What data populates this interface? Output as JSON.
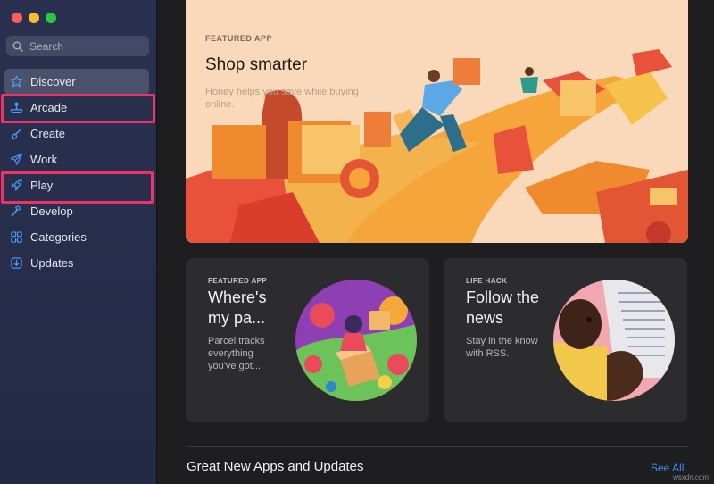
{
  "window": {
    "traffic_lights": [
      "close",
      "minimize",
      "zoom"
    ]
  },
  "sidebar": {
    "search_placeholder": "Search",
    "items": [
      {
        "label": "Discover",
        "icon": "star-icon",
        "selected": true
      },
      {
        "label": "Arcade",
        "icon": "joystick-icon",
        "highlighted": true
      },
      {
        "label": "Create",
        "icon": "brush-icon"
      },
      {
        "label": "Work",
        "icon": "paper-plane-icon"
      },
      {
        "label": "Play",
        "icon": "rocket-icon",
        "highlighted": true
      },
      {
        "label": "Develop",
        "icon": "hammer-icon"
      },
      {
        "label": "Categories",
        "icon": "grid-icon"
      },
      {
        "label": "Updates",
        "icon": "download-icon"
      }
    ],
    "highlight_color": "#ec3266"
  },
  "hero": {
    "eyebrow": "FEATURED APP",
    "title": "Shop smarter",
    "description": "Honey helps you save while buying online."
  },
  "cards": [
    {
      "eyebrow": "FEATURED APP",
      "title": "Where's my pa...",
      "description": "Parcel tracks everything you've got..."
    },
    {
      "eyebrow": "LIFE HACK",
      "title": "Follow the news",
      "description": "Stay in the know with RSS."
    }
  ],
  "section": {
    "title": "Great New Apps and Updates",
    "see_all": "See All"
  },
  "watermark": "wsxdn.com",
  "colors": {
    "accent": "#3f8ef5",
    "sidebar_bg": "#2a3150",
    "main_bg": "#1e1e20"
  }
}
